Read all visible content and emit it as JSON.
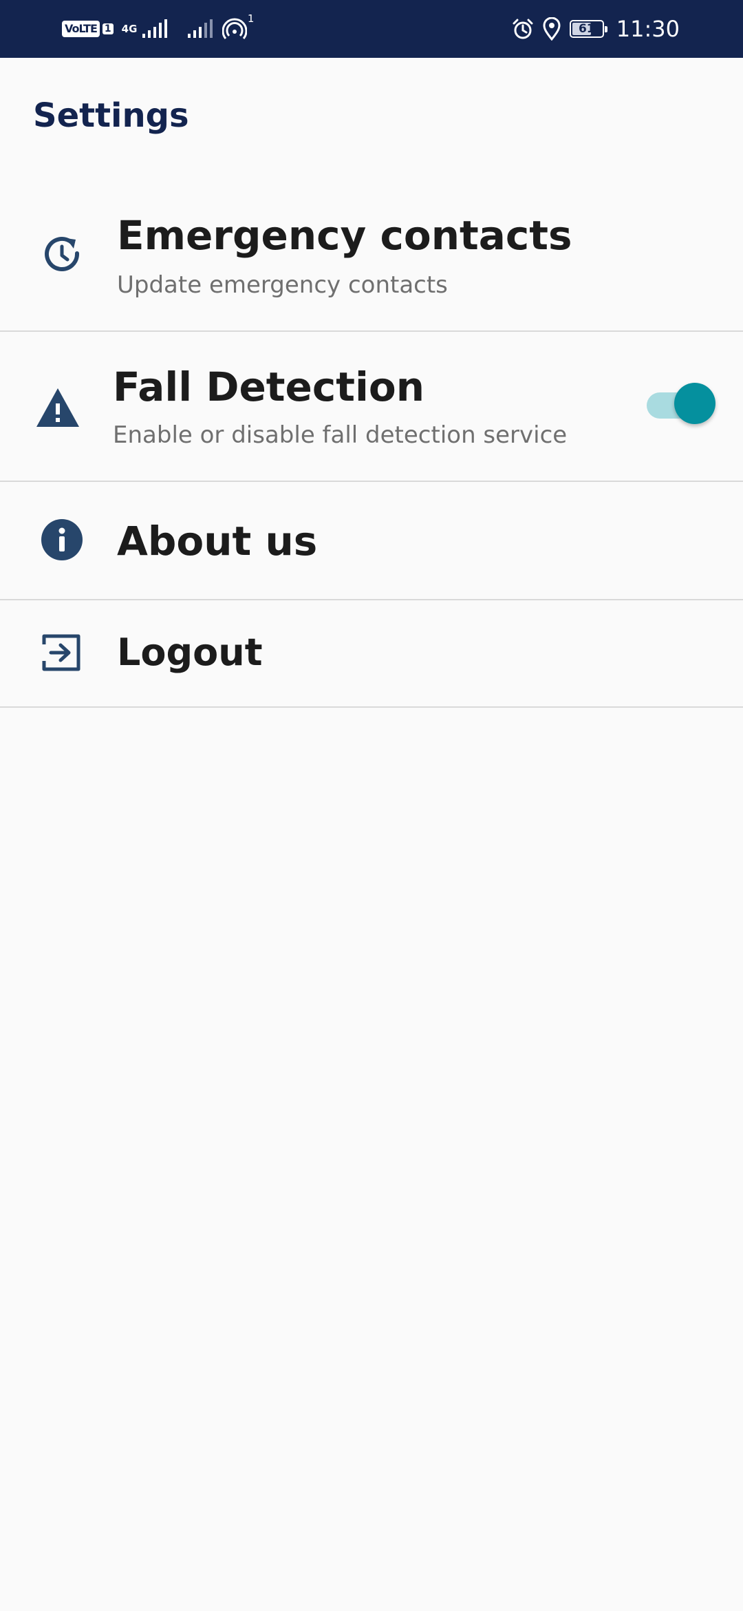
{
  "status_bar": {
    "volte": "VoLTE",
    "sim": "1",
    "network": "4G",
    "hotspot_count": "1",
    "battery": "61",
    "time": "11:30",
    "icons": [
      "volte-icon",
      "signal-icon",
      "signal-icon",
      "hotspot-icon",
      "alarm-icon",
      "location-icon",
      "battery-icon"
    ]
  },
  "header": {
    "title": "Settings"
  },
  "settings": {
    "items": [
      {
        "label": "Emergency contacts",
        "subtitle": "Update emergency contacts",
        "icon": "update-clock-icon"
      },
      {
        "label": "Fall Detection",
        "subtitle": "Enable or disable fall detection service",
        "icon": "warning-icon",
        "toggle_on": true
      },
      {
        "label": "About us",
        "icon": "info-icon"
      },
      {
        "label": "Logout",
        "icon": "logout-icon"
      }
    ]
  },
  "colors": {
    "status_bar_bg": "#13244f",
    "icon_color": "#27466b",
    "accent": "#05909e",
    "accent_track": "#a9dbe0",
    "background": "#fafafa"
  }
}
